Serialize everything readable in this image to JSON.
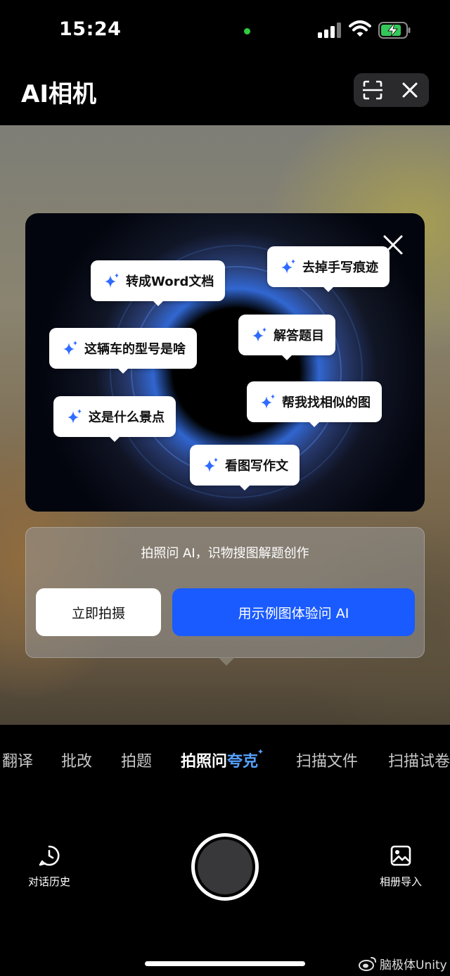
{
  "status_bar": {
    "time": "15:24"
  },
  "header": {
    "title": "AI相机"
  },
  "promo": {
    "bubbles": [
      {
        "label": "转成Word文档"
      },
      {
        "label": "去掉手写痕迹"
      },
      {
        "label": "这辆车的型号是啥"
      },
      {
        "label": "解答题目"
      },
      {
        "label": "帮我找相似的图"
      },
      {
        "label": "这是什么景点"
      },
      {
        "label": "看图写作文"
      }
    ]
  },
  "info_panel": {
    "text": "拍照问 AI，识物搜图解题创作",
    "shoot_label": "立即拍摄",
    "sample_label": "用示例图体验问 AI"
  },
  "mode_tabs": {
    "items": [
      {
        "label": "翻译"
      },
      {
        "label": "批改"
      },
      {
        "label": "拍题"
      },
      {
        "label_main": "拍照问",
        "label_accent": "夸克",
        "active": true
      },
      {
        "label": "扫描文件"
      },
      {
        "label": "扫描试卷"
      }
    ]
  },
  "bottom": {
    "history_label": "对话历史",
    "album_label": "相册导入"
  },
  "watermark": {
    "text": "脑极体Unity"
  },
  "colors": {
    "accent_blue": "#1a5bff",
    "tab_accent": "#56a2ff",
    "status_green": "#2ecc40",
    "battery_green": "#34c759"
  }
}
